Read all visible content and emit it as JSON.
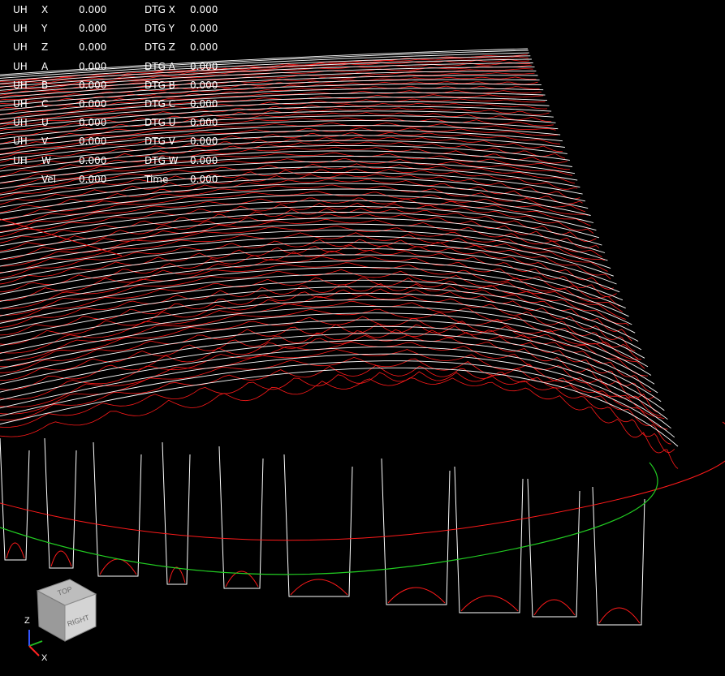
{
  "dro": {
    "rows": [
      {
        "unit": "UH",
        "axis": "X",
        "value": "0.000",
        "dtg_label": "DTG X",
        "dtg_value": "0.000"
      },
      {
        "unit": "UH",
        "axis": "Y",
        "value": "0.000",
        "dtg_label": "DTG Y",
        "dtg_value": "0.000"
      },
      {
        "unit": "UH",
        "axis": "Z",
        "value": "0.000",
        "dtg_label": "DTG Z",
        "dtg_value": "0.000"
      },
      {
        "unit": "UH",
        "axis": "A",
        "value": "0.000",
        "dtg_label": "DTG A",
        "dtg_value": "0.000"
      },
      {
        "unit": "UH",
        "axis": "B",
        "value": "0.000",
        "dtg_label": "DTG B",
        "dtg_value": "0.000"
      },
      {
        "unit": "UH",
        "axis": "C",
        "value": "0.000",
        "dtg_label": "DTG C",
        "dtg_value": "0.000"
      },
      {
        "unit": "UH",
        "axis": "U",
        "value": "0.000",
        "dtg_label": "DTG U",
        "dtg_value": "0.000"
      },
      {
        "unit": "UH",
        "axis": "V",
        "value": "0.000",
        "dtg_label": "DTG V",
        "dtg_value": "0.000"
      },
      {
        "unit": "UH",
        "axis": "W",
        "value": "0.000",
        "dtg_label": "DTG W",
        "dtg_value": "0.000"
      },
      {
        "unit": "",
        "axis": "Vel",
        "value": "0.000",
        "dtg_label": "Time",
        "dtg_value": "0.000"
      }
    ]
  },
  "view_cube": {
    "top_label": "TOP",
    "right_label": "RIGHT",
    "axis_z": "Z",
    "axis_x": "X"
  },
  "colors": {
    "background": "#000000",
    "dro_text": "#ffffff",
    "feed_path": "#ff1a1a",
    "rapid_path": "#ffffff",
    "limit_arc": "#22cc22",
    "axis_z": "#3355ff",
    "axis_y": "#22bb22",
    "axis_x": "#ff2222"
  }
}
